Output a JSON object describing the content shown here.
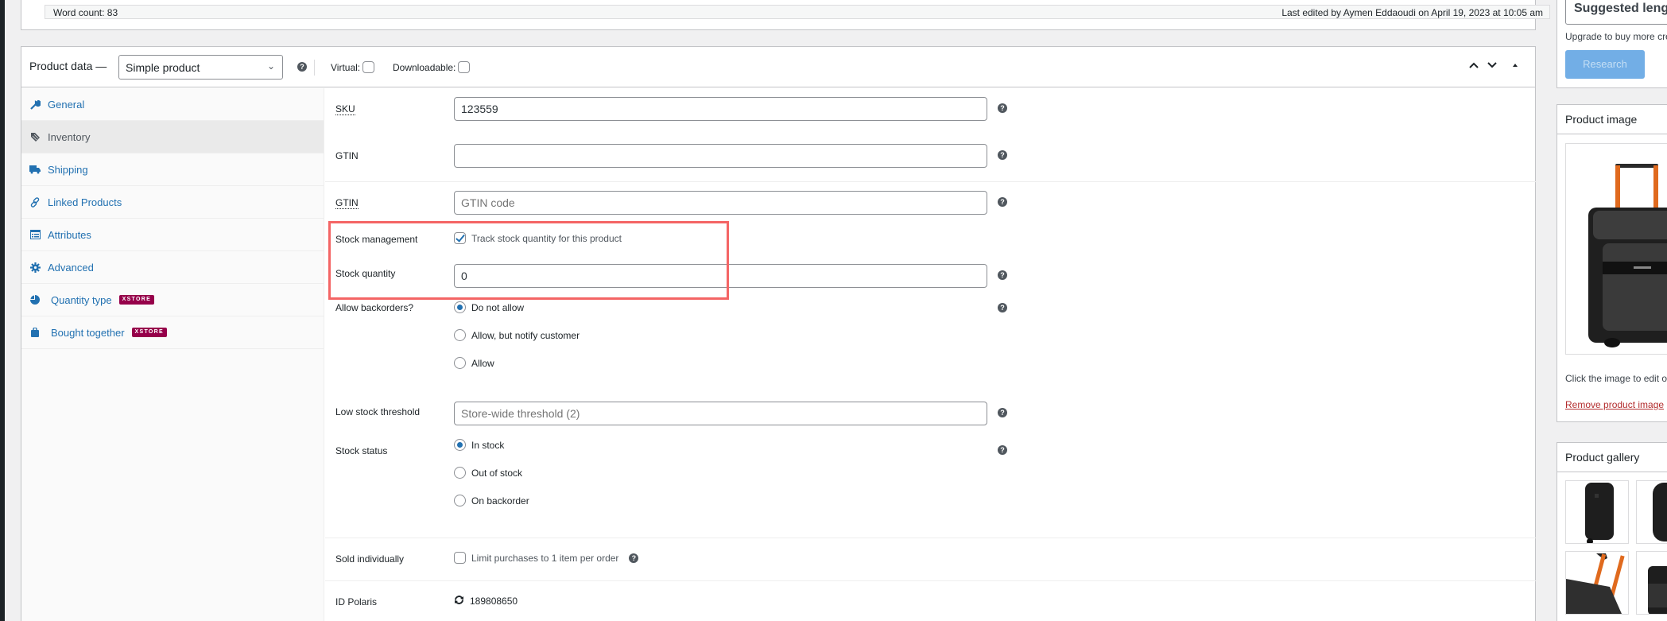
{
  "editor": {
    "word_count": "Word count: 83",
    "last_edited": "Last edited by Aymen Eddaoudi on April 19, 2023 at 10:05 am"
  },
  "product_data": {
    "title": "Product data —",
    "type_select": "Simple product",
    "virtual_label": "Virtual:",
    "virtual_checked": false,
    "downloadable_label": "Downloadable:",
    "downloadable_checked": false,
    "controls": {
      "move_up": "up-arrow",
      "move_down": "down-arrow",
      "toggle": "collapse-triangle"
    }
  },
  "tabs": [
    {
      "label": "General",
      "icon": "wrench-icon",
      "active": false
    },
    {
      "label": "Inventory",
      "icon": "tag-icon",
      "active": true
    },
    {
      "label": "Shipping",
      "icon": "truck-icon",
      "active": false
    },
    {
      "label": "Linked Products",
      "icon": "link-icon",
      "active": false
    },
    {
      "label": "Attributes",
      "icon": "list-icon",
      "active": false
    },
    {
      "label": "Advanced",
      "icon": "gear-icon",
      "active": false
    },
    {
      "label": "Quantity type",
      "icon": "pie-chart-icon",
      "badge": "XSTORE",
      "active": false
    },
    {
      "label": "Bought together",
      "icon": "bag-icon",
      "badge": "XSTORE",
      "active": false
    }
  ],
  "inventory": {
    "sku": {
      "label": "SKU",
      "value": "123559"
    },
    "gtin1": {
      "label": "GTIN",
      "value": ""
    },
    "gtin2": {
      "label": "GTIN",
      "placeholder": "GTIN code"
    },
    "stock_management": {
      "label": "Stock management",
      "option": "Track stock quantity for this product",
      "checked": true
    },
    "stock_quantity": {
      "label": "Stock quantity",
      "value": "0"
    },
    "backorders": {
      "label": "Allow backorders?",
      "options": [
        "Do not allow",
        "Allow, but notify customer",
        "Allow"
      ],
      "selected": "Do not allow"
    },
    "low_stock": {
      "label": "Low stock threshold",
      "placeholder": "Store-wide threshold (2)"
    },
    "stock_status": {
      "label": "Stock status",
      "options": [
        "In stock",
        "Out of stock",
        "On backorder"
      ],
      "selected": "In stock"
    },
    "sold_individually": {
      "label": "Sold individually",
      "option": "Limit purchases to 1 item per order",
      "checked": false
    },
    "id_polaris": {
      "label": "ID Polaris",
      "value": "189808650"
    }
  },
  "sidebar": {
    "suggested": "Suggested length",
    "upgrade": "Upgrade to buy more credits",
    "research_button": "Research",
    "product_image": {
      "title": "Product image",
      "hint": "Click the image to edit or update",
      "remove_link": "Remove product image"
    },
    "product_gallery": {
      "title": "Product gallery"
    }
  },
  "colors": {
    "link": "#2271b1",
    "badge": "#96004a",
    "highlight": "#f46565",
    "research_button": "#72aee6",
    "remove_link": "#b32d2e"
  }
}
